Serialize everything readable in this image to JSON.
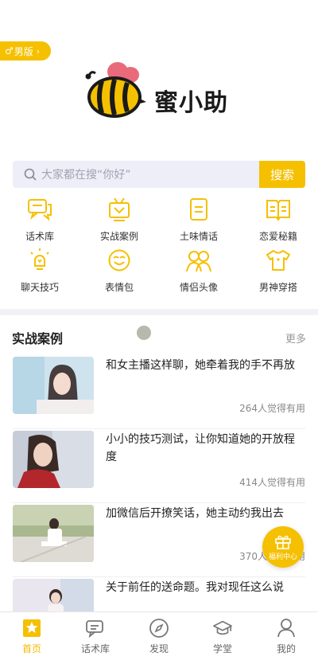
{
  "header": {
    "gender_switch": {
      "symbol": "♂",
      "label": "男版",
      "chevron": "›"
    },
    "app_name": "蜜小助"
  },
  "search": {
    "placeholder": "大家都在搜“你好”",
    "button_label": "搜索"
  },
  "shortcuts": [
    {
      "label": "话术库",
      "icon": "chat-bubbles-icon"
    },
    {
      "label": "实战案例",
      "icon": "tv-icon"
    },
    {
      "label": "土味情话",
      "icon": "note-icon"
    },
    {
      "label": "恋爱秘籍",
      "icon": "open-book-icon"
    },
    {
      "label": "聊天技巧",
      "icon": "lightbulb-icon"
    },
    {
      "label": "表情包",
      "icon": "smiley-icon"
    },
    {
      "label": "情侣头像",
      "icon": "couple-icon"
    },
    {
      "label": "男神穿搭",
      "icon": "tshirt-icon"
    }
  ],
  "cases_section": {
    "title": "实战案例",
    "more_label": "更多",
    "items": [
      {
        "title": "和女主播这样聊，她牵着我的手不再放",
        "meta": "264人觉得有用"
      },
      {
        "title": "小小的技巧测试，让你知道她的开放程度",
        "meta": "414人觉得有用"
      },
      {
        "title": "加微信后开撩笑话，她主动约我出去",
        "meta": "370人觉得有用"
      },
      {
        "title": "关于前任的送命题。我对现任这么说",
        "meta": ""
      }
    ]
  },
  "fab": {
    "label": "福利中心",
    "icon": "gift-icon"
  },
  "tabbar": [
    {
      "label": "首页",
      "icon": "home-star-icon",
      "active": true
    },
    {
      "label": "话术库",
      "icon": "chat-icon",
      "active": false
    },
    {
      "label": "发现",
      "icon": "compass-icon",
      "active": false
    },
    {
      "label": "学堂",
      "icon": "graduation-cap-icon",
      "active": false
    },
    {
      "label": "我的",
      "icon": "user-icon",
      "active": false
    }
  ],
  "colors": {
    "brand": "#f5c000",
    "search_bg": "#eeeef8"
  }
}
